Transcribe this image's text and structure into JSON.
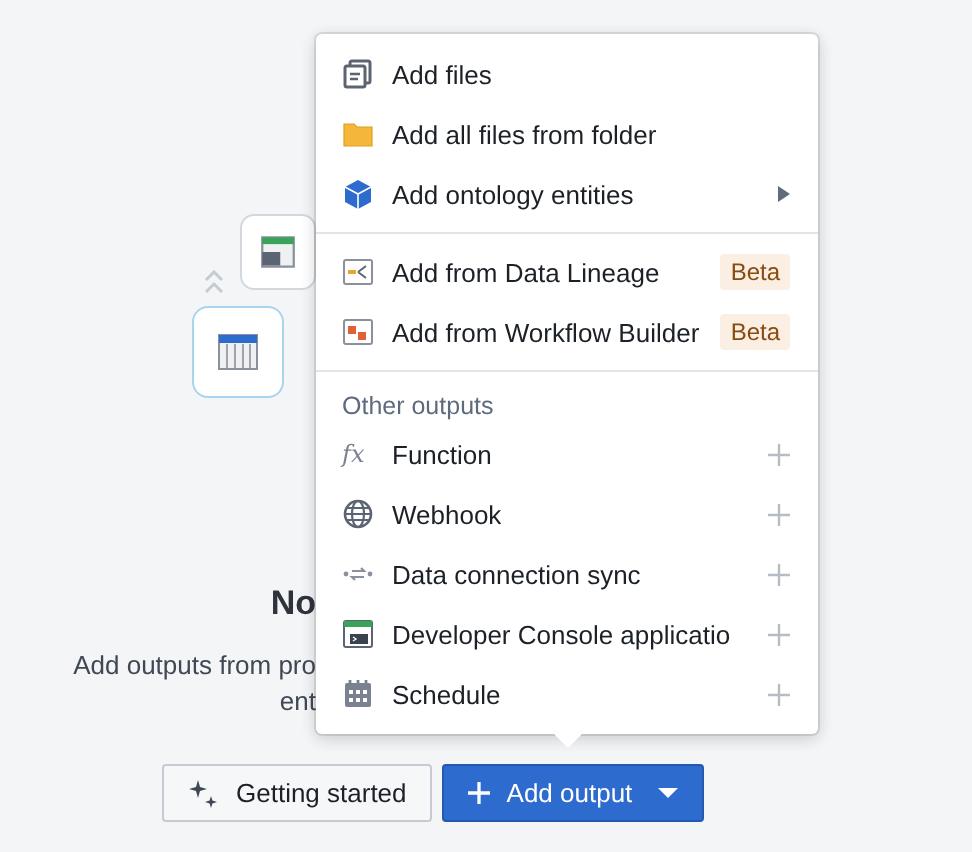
{
  "empty_state": {
    "title": "No",
    "description_lines": [
      "Add outputs from pro",
      "ent"
    ]
  },
  "buttons": [
    {
      "label": "Getting started",
      "kind": "secondary"
    },
    {
      "label": "Add output",
      "kind": "primary"
    }
  ],
  "menu": {
    "sections": [
      {
        "items": [
          {
            "label": "Add files",
            "has_submenu": false
          },
          {
            "label": "Add all files from folder",
            "has_submenu": false
          },
          {
            "label": "Add ontology entities",
            "has_submenu": true
          }
        ]
      },
      {
        "items": [
          {
            "label": "Add from Data Lineage",
            "badge": "Beta",
            "has_submenu": false
          },
          {
            "label": "Add from Workflow Builder",
            "badge": "Beta",
            "has_submenu": false
          }
        ]
      }
    ],
    "other_outputs": {
      "heading": "Other outputs",
      "items": [
        {
          "label": "Function",
          "icon_text": "fx"
        },
        {
          "label": "Webhook"
        },
        {
          "label": "Data connection sync"
        },
        {
          "label": "Developer Console applicatio"
        },
        {
          "label": "Schedule"
        }
      ]
    }
  }
}
